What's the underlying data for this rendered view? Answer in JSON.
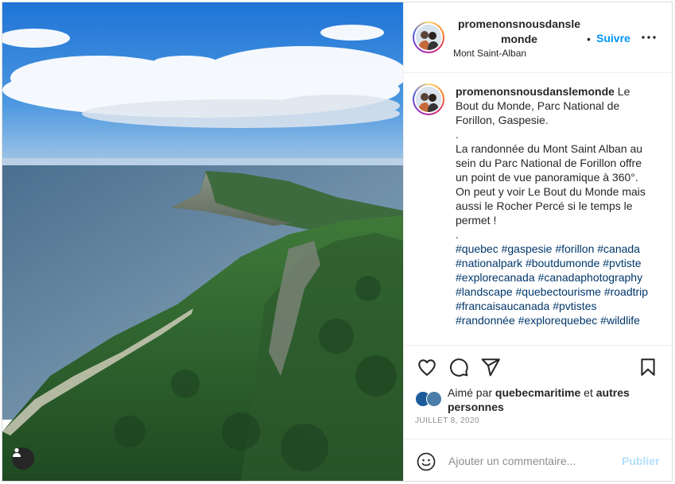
{
  "post": {
    "username": "promenonsnousdanslemonde",
    "location": "Mont Saint-Alban",
    "dot": "•",
    "follow_label": "Suivre",
    "icons": {
      "more": "more-options-icon",
      "user_tag": "user-tag-icon",
      "like": "heart-icon",
      "comment": "comment-icon",
      "share": "paper-plane-icon",
      "save": "bookmark-icon",
      "emoji": "emoji-icon"
    }
  },
  "caption": {
    "username": "promenonsnousdanslemonde",
    "line1": " Le Bout du Monde, Parc National de Forillon, Gaspesie.",
    "dot1": ".",
    "body": "La randonnée du Mont Saint Alban au sein du Parc National de Forillon offre un point de vue panoramique à 360°. On peut y voir Le Bout du Monde mais aussi le Rocher Percé si le temps le permet !",
    "dot2": ".",
    "hashtags": [
      "#quebec",
      "#gaspesie",
      "#forillon",
      "#canada",
      "#nationalpark",
      "#boutdumonde",
      "#pvtiste",
      "#explorecanada",
      "#canadaphotography",
      "#landscape",
      "#quebectourisme",
      "#roadtrip",
      "#francaisaucanada",
      "#pvtistes",
      "#randonnée",
      "#explorequebec",
      "#wildlife"
    ]
  },
  "likes": {
    "prefix": "Aimé par ",
    "user": "quebecmaritime",
    "middle": " et ",
    "others": "autres personnes"
  },
  "date": "JUILLET 8, 2020",
  "comment": {
    "placeholder": "Ajouter un commentaire...",
    "publish_label": "Publier"
  },
  "colors": {
    "link_blue": "#0095f6",
    "hashtag": "#00376b",
    "publish_disabled": "#b2dffc",
    "muted": "#8e8e8e"
  }
}
